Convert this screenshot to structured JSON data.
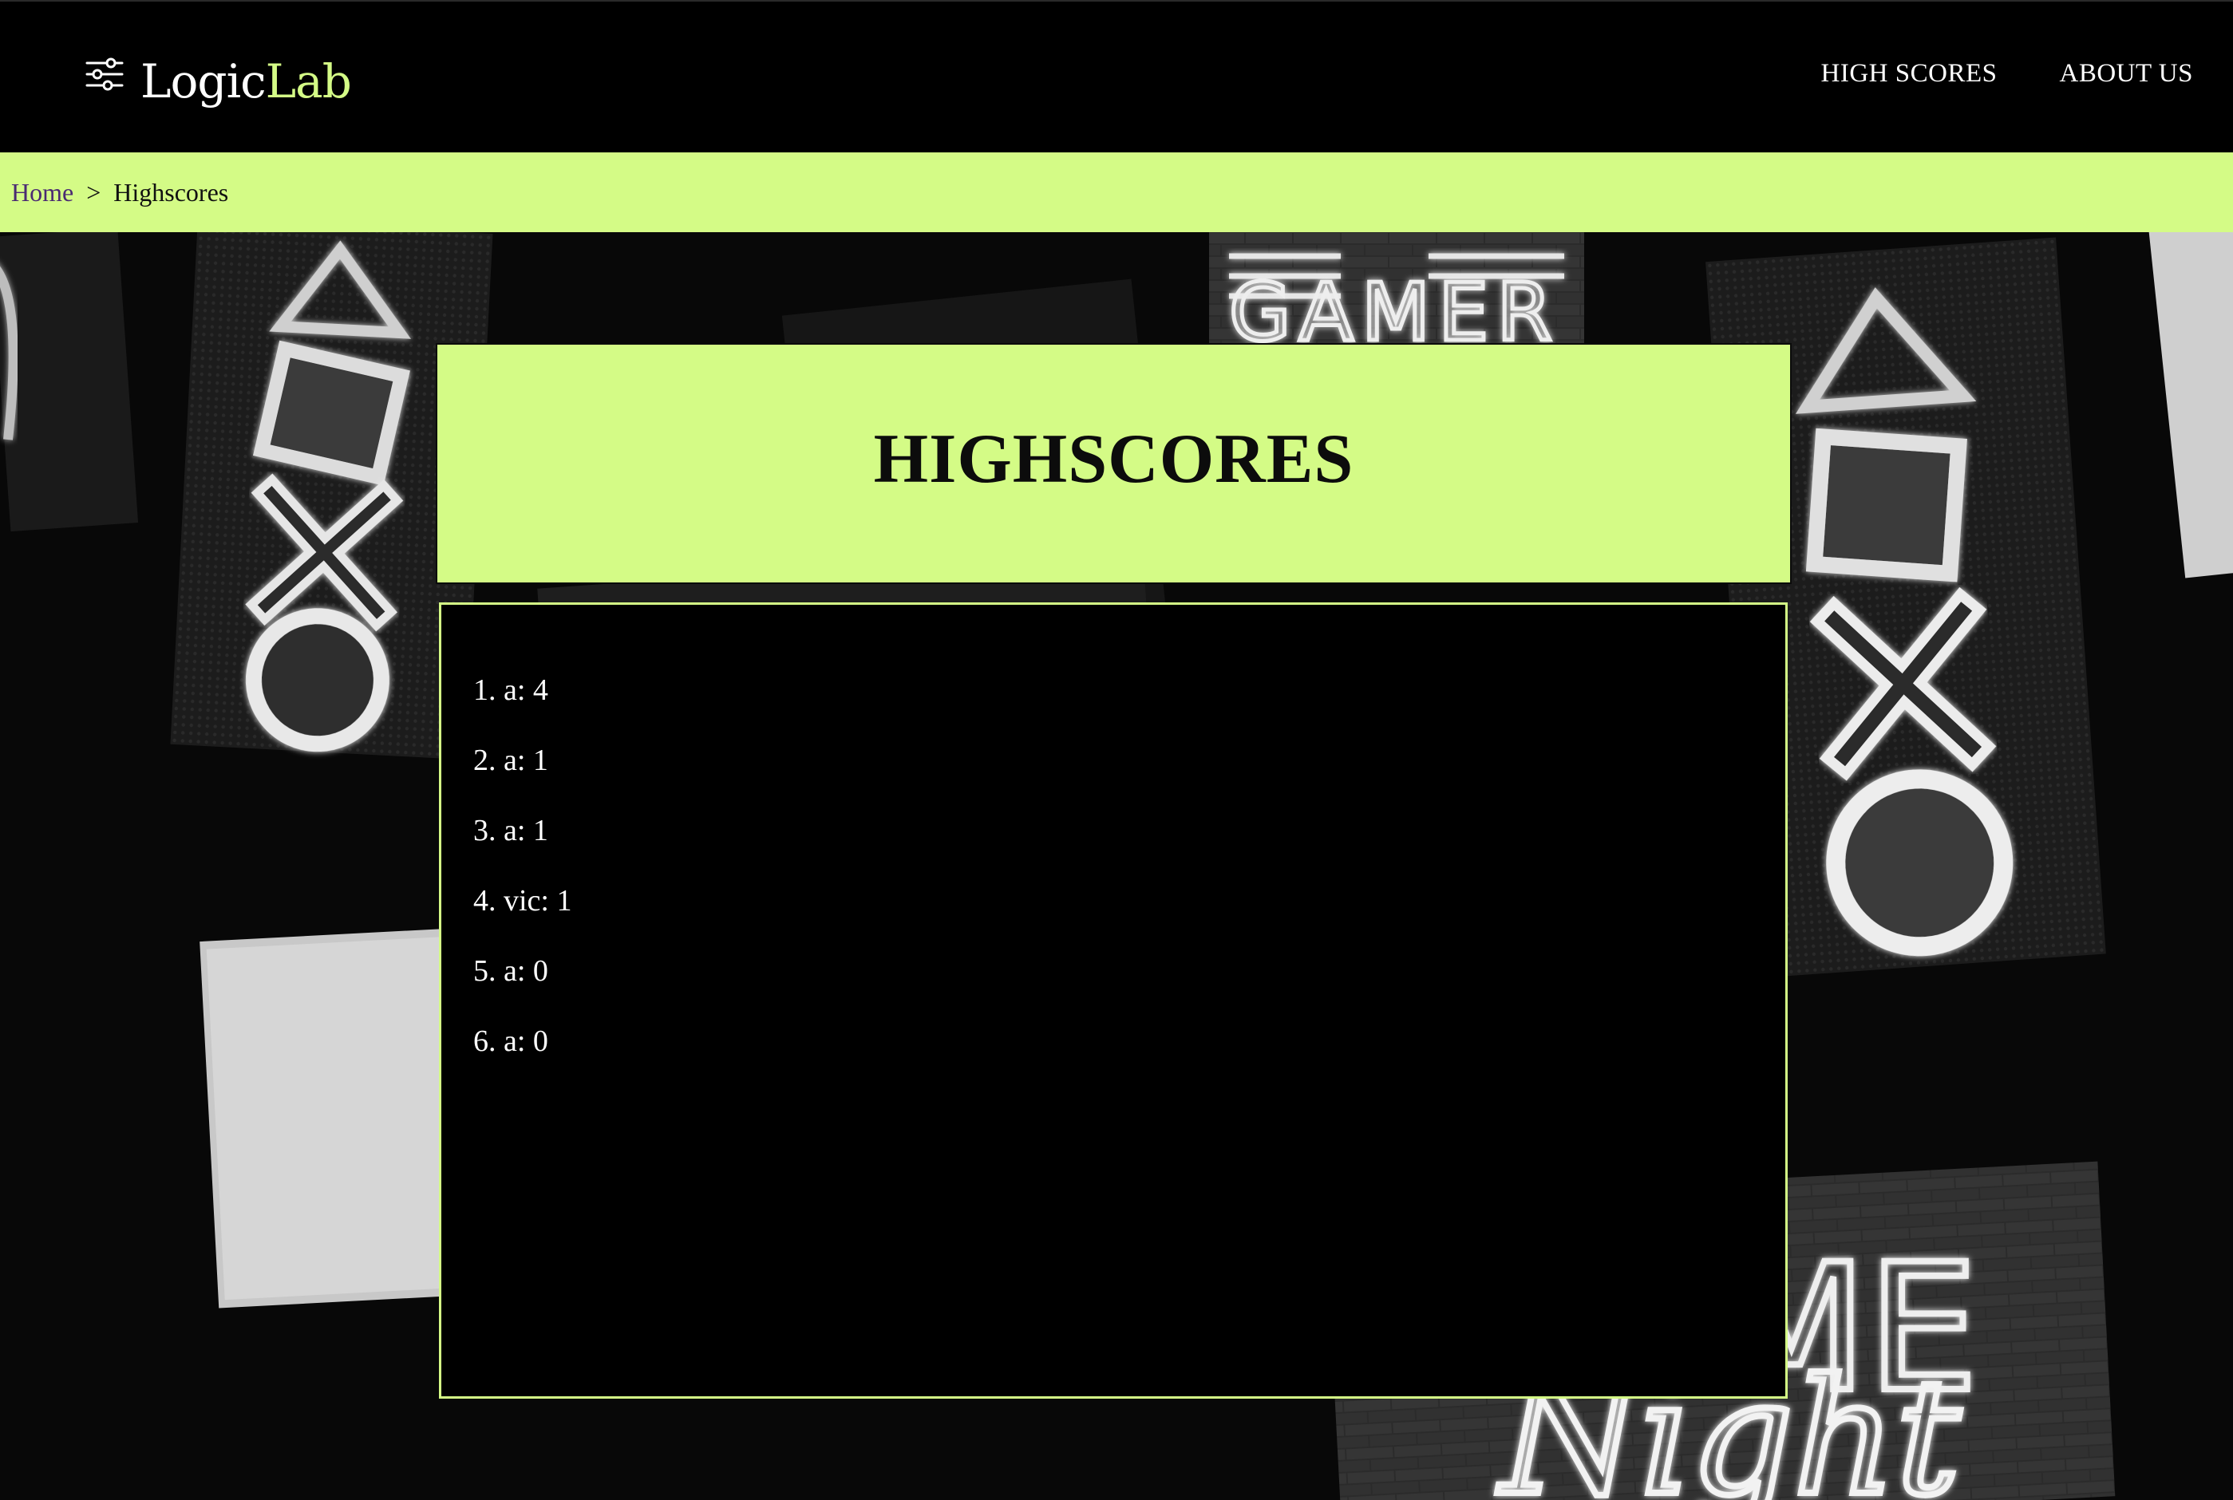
{
  "theme": {
    "accent": "#d4fb86",
    "header_bg": "#000000"
  },
  "brand": {
    "icon": "sliders-icon",
    "name_part1": "Logic",
    "name_part2": "Lab"
  },
  "nav": {
    "items": [
      {
        "label": "HIGH SCORES"
      },
      {
        "label": "ABOUT US"
      }
    ]
  },
  "breadcrumb": {
    "home": "Home",
    "separator": ">",
    "current": "Highscores"
  },
  "page": {
    "title": "HIGHSCORES"
  },
  "scores": [
    {
      "text": "1. a: 4"
    },
    {
      "text": "2. a: 1"
    },
    {
      "text": "3. a: 1"
    },
    {
      "text": "4. vic: 1"
    },
    {
      "text": "5. a: 0"
    },
    {
      "text": "6. a: 0"
    }
  ]
}
